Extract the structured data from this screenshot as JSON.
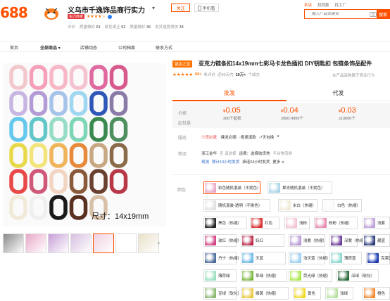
{
  "header": {
    "logo": "688",
    "shop_name": "义乌市千逸饰品商行实力",
    "shop_arrow": "▾",
    "badge": "实力商家",
    "stars": "★★★★☆",
    "scores": [
      {
        "label": "评价",
        "value": ""
      },
      {
        "label": "质量做好",
        "value": "61"
      },
      {
        "label": "颜色很正",
        "value": "52"
      },
      {
        "label": "质量做好",
        "value": "36"
      },
      {
        "label": "发货速度很快",
        "value": "33"
      }
    ],
    "follow_label": "关注",
    "mobile_label": "手机看",
    "search_tabs": [
      "本店",
      "找同款",
      "找工厂"
    ],
    "search_placeholder": "输入产品关键词",
    "search_button": "搜索"
  },
  "nav": {
    "items": [
      "首页",
      "全部商品",
      "店铺动态",
      "公司档案",
      "联系方式"
    ]
  },
  "gallery": {
    "size_text": "尺寸：14x19mm",
    "thumb_count": 7,
    "next_arrow": "›"
  },
  "product": {
    "title_badge": "镇店之宝",
    "title": "亚克力链条扣14x19mm七彩马卡龙色插扣 DIY钥匙扣 包链条饰品配件",
    "stars": "★★★★★",
    "rating_count": "60+",
    "rating_label": "条评价",
    "sales_label": "近90天内",
    "sales_value": "10万+",
    "sales_unit": "个成交",
    "same_shop": "本产品采购属于商业行为",
    "tab_wholesale": "批发",
    "tab_dropship": "代发"
  },
  "price": {
    "label_price": "价格",
    "label_start": "起批量",
    "tiers": [
      {
        "price": "0.05",
        "qty": "200个起批"
      },
      {
        "price": "0.04",
        "qty": "2000-9999个"
      },
      {
        "price": "0.03",
        "qty": "≥10000个"
      }
    ],
    "currency": "¥"
  },
  "service": {
    "label": "服务",
    "items": [
      "少货必退",
      "·晚发必赔",
      "·极速退款",
      "·7天包换",
      "∨"
    ]
  },
  "logistics": {
    "label": "物流",
    "origin": "浙江金华",
    "to": "至 请选择",
    "freight": "运费：选择收货地",
    "platform": "平台物流券",
    "observe": "观测",
    "eta": "预计10小时发货",
    "promise": "承诺24小时发货",
    "more": "更多 ∨"
  },
  "colors": {
    "label": "颜色",
    "options": [
      {
        "name": "彩色随机混装（不挑色）",
        "color": "#e8a8c8"
      },
      {
        "name": "果冻随机混装（不挑色）",
        "color": "#a8d4e8"
      },
      {
        "name": "随机混装-透明（不挑色）",
        "color": "#e0e0e0"
      },
      {
        "name": "米白（热缩）",
        "color": "#f2ead8"
      },
      {
        "name": "白色（热缩）",
        "color": "#f8f8f8"
      },
      {
        "name": "黑色（热缩）",
        "color": "#222222"
      },
      {
        "name": "红色",
        "color": "#d83030"
      },
      {
        "name": "浅粉",
        "color": "#f4c4d4"
      },
      {
        "name": "粉粉（热缩）",
        "color": "#e88ab0"
      },
      {
        "name": "浅紫",
        "color": "#c0a0d8"
      },
      {
        "name": "玫红（热缩）",
        "color": "#d04080"
      },
      {
        "name": "妖红",
        "color": "#b82848"
      },
      {
        "name": "浅紫（热缩）",
        "color": "#b89ad4"
      },
      {
        "name": "深紫（热缩）",
        "color": "#6a3a9a"
      },
      {
        "name": "藏蓝",
        "color": "#2a3a7a"
      },
      {
        "name": "丹宁（热缩）",
        "color": "#4a6a9a"
      },
      {
        "name": "天蓝",
        "color": "#6ab8e8"
      },
      {
        "name": "浅天蓝（热缩）",
        "color": "#9ad0f0"
      },
      {
        "name": "薄荷蓝",
        "color": "#8ad8d0"
      },
      {
        "name": "克莱因蓝",
        "color": "#1a3ab0"
      },
      {
        "name": "薄荷绿",
        "color": "#9ae0c0"
      },
      {
        "name": "草绿（热缩）",
        "color": "#7ab840"
      },
      {
        "name": "荧光绿（热缩）",
        "color": "#a8e848"
      },
      {
        "name": "深绿（软化）",
        "color": "#2a6a3a"
      },
      {
        "name": "豆绿（软化）",
        "color": "#8ab870"
      },
      {
        "name": "姨黄（热缩）",
        "color": "#e8c840"
      },
      {
        "name": "黄色",
        "color": "#f0d820"
      },
      {
        "name": "浅绿",
        "color": "#b8e0a0"
      },
      {
        "name": "橙色",
        "color": "#f08830"
      }
    ]
  },
  "swatch_colors": [
    [
      "#f2c8cc",
      "#f5a0b8",
      "#f7b7c6",
      "#f5c2d0",
      "#e06aa0",
      "#d85a8c"
    ],
    [
      "#c8b6e2",
      "#b39bd6",
      "#a6c4ea",
      "#9fd6f0",
      "#2f57b8",
      "#8a7aa8"
    ],
    [
      "#66c8ec",
      "#63c6c8",
      "#96dcc6",
      "#7dd7b6",
      "#3a8a50",
      "#4e8f60"
    ],
    [
      "#e8d94a",
      "#f2e47a",
      "#f0b45a",
      "#e7893a",
      "#c8a882",
      "#8a6a48"
    ],
    [
      "#e84848",
      "#d05878",
      "#f2d4c2",
      "#8a5a3a",
      "#6a4030",
      "#b83848"
    ],
    [
      "#f2ead8",
      "#f0f0f0",
      "#1a1a1a",
      "#5a3020",
      "#d8c0a8"
    ]
  ]
}
